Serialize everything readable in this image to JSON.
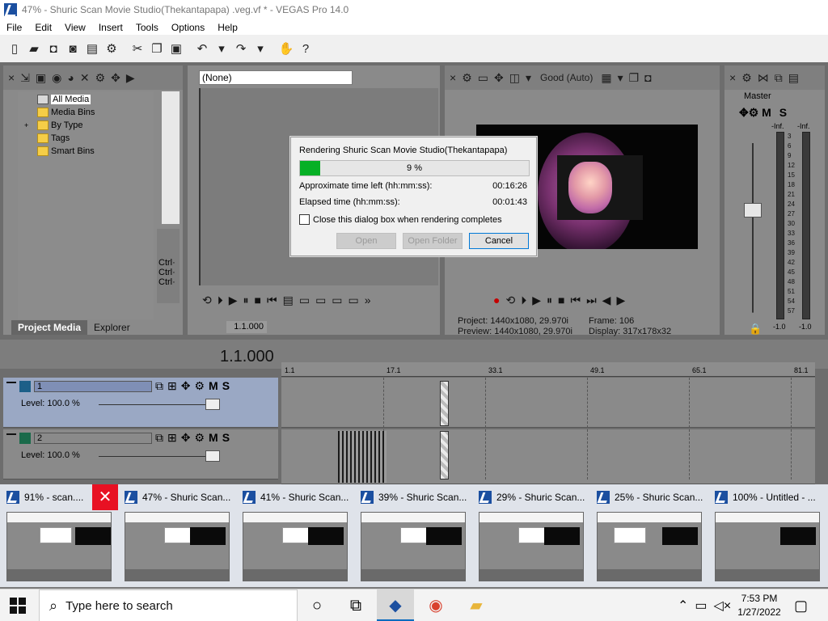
{
  "window": {
    "title": "47% - Shuric Scan Movie Studio(Thekantapapa) .veg.vf * - VEGAS Pro 14.0"
  },
  "menu": [
    "File",
    "Edit",
    "View",
    "Insert",
    "Tools",
    "Options",
    "Help"
  ],
  "project_media": {
    "tree": [
      "All Media",
      "Media Bins",
      "By Type",
      "Tags",
      "Smart Bins"
    ],
    "expander": "+",
    "tabs": [
      "Project Media",
      "Explorer"
    ],
    "side_labels": [
      "Ctrl·",
      "Ctrl·",
      "Ctrl·"
    ]
  },
  "trimmer": {
    "selector": "(None)",
    "timecode": "1.1.000"
  },
  "preview": {
    "quality": "Good (Auto)",
    "project_label": "Project:",
    "project_value": "1440x1080, 29.970i",
    "preview_label": "Preview:",
    "preview_value": "1440x1080, 29.970i",
    "frame_label": "Frame:",
    "frame_value": "106",
    "display_label": "Display:",
    "display_value": "317x178x32"
  },
  "master": {
    "label": "Master",
    "m": "M",
    "s": "S",
    "inf_left": "-Inf.",
    "inf_right": "-Inf.",
    "scale": [
      "3",
      "6",
      "9",
      "12",
      "15",
      "18",
      "21",
      "24",
      "27",
      "30",
      "33",
      "36",
      "39",
      "42",
      "45",
      "48",
      "51",
      "54",
      "57"
    ],
    "bottom_left": "-1.0",
    "bottom_right": "-1.0"
  },
  "timeline": {
    "time": "1.1.000",
    "ruler": [
      "1.1",
      "17.1",
      "33.1",
      "49.1",
      "65.1",
      "81.1"
    ],
    "tracks": [
      {
        "num": "1",
        "level": "Level: 100.0 %"
      },
      {
        "num": "2",
        "level": "Level: 100.0 %"
      }
    ],
    "m": "M",
    "s": "S"
  },
  "dialog": {
    "title": "Rendering Shuric Scan Movie Studio(Thekantapapa)",
    "progress_text": "9 %",
    "progress_fraction": 0.09,
    "time_left_label": "Approximate time left (hh:mm:ss):",
    "time_left": "00:16:26",
    "elapsed_label": "Elapsed time (hh:mm:ss):",
    "elapsed": "00:01:43",
    "checkbox_label": "Close this dialog box when rendering completes",
    "open": "Open",
    "open_folder": "Open Folder",
    "cancel": "Cancel"
  },
  "thumbnails": [
    {
      "label": "91% - scan...."
    },
    {
      "label": "47% - Shuric Scan..."
    },
    {
      "label": "41% - Shuric Scan..."
    },
    {
      "label": "39% - Shuric Scan..."
    },
    {
      "label": "29% - Shuric Scan..."
    },
    {
      "label": "25% - Shuric Scan..."
    },
    {
      "label": "100% - Untitled - ..."
    }
  ],
  "taskbar": {
    "search_placeholder": "Type here to search",
    "time": "7:53 PM",
    "date": "1/27/2022"
  },
  "colors": {
    "progress_fill": "#06b025",
    "close_red": "#e81123",
    "accent_blue": "#0078d7"
  }
}
